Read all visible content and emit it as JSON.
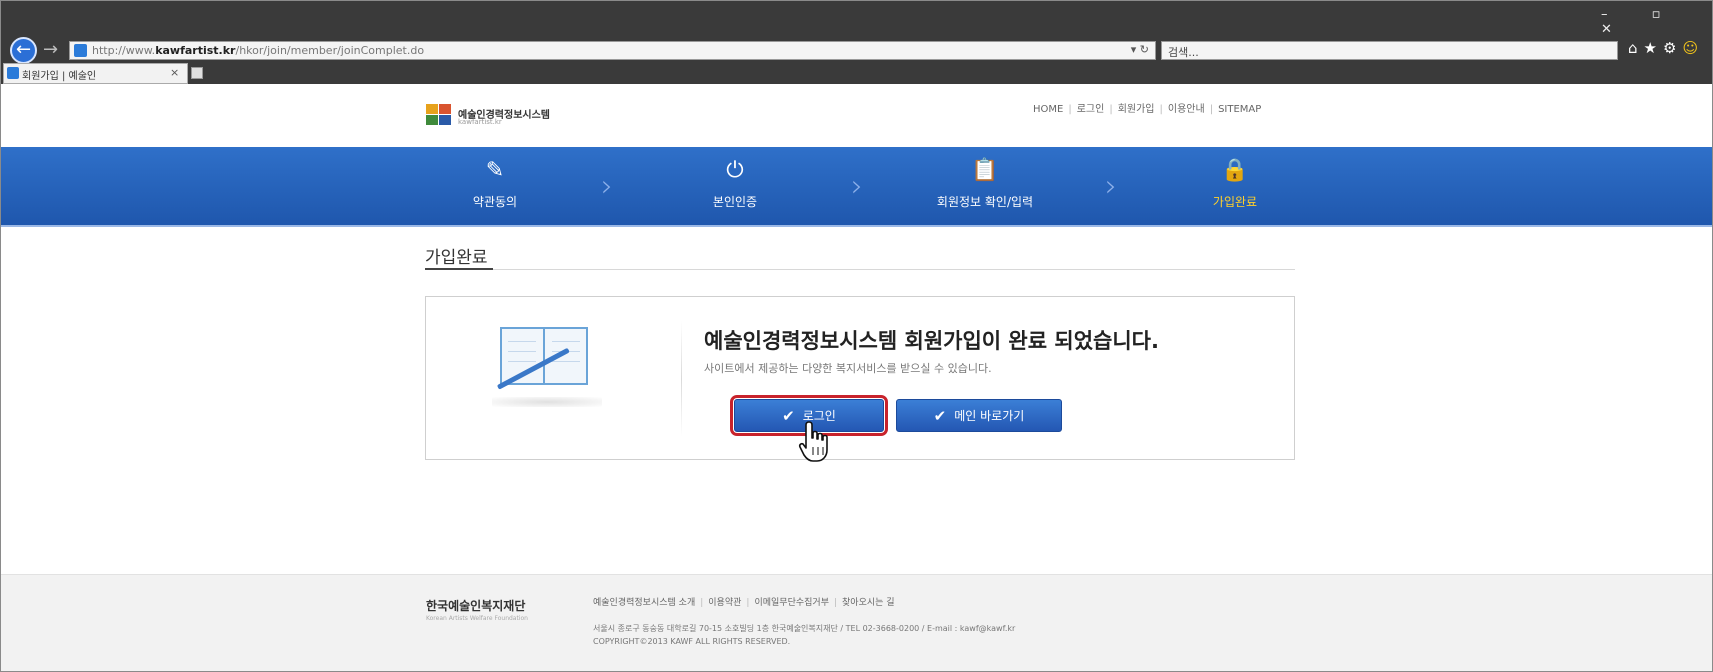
{
  "browser": {
    "url_prefix": "http://www.",
    "url_domain": "kawfartist.kr",
    "url_path": "/hkor/join/member/joinComplet.do",
    "refresh_glyph": "▾ ↻",
    "search_placeholder": "검색...",
    "tab_title": "회원가입 | 예술인",
    "tab_close": "×",
    "win_controls": "–  ▫  ✕",
    "toolbar_icons": [
      "home-icon",
      "star-icon",
      "gear-icon",
      "smiley-icon"
    ]
  },
  "site": {
    "logo_title": "예술인경력정보시스템",
    "logo_sub": "kawfartist.kr",
    "top_links": [
      "HOME",
      "로그인",
      "회원가입",
      "이용안내",
      "SITEMAP"
    ]
  },
  "steps": [
    {
      "label": "약관동의",
      "icon": "document-edit-icon",
      "glyph": "✎"
    },
    {
      "label": "본인인증",
      "icon": "power-icon",
      "glyph": "⏻"
    },
    {
      "label": "회원정보 확인/입력",
      "icon": "clipboard-search-icon",
      "glyph": "📋"
    },
    {
      "label": "가입완료",
      "icon": "lock-icon",
      "glyph": "🔒",
      "active": true
    }
  ],
  "content": {
    "section_title": "가입완료",
    "message_title": "예술인경력정보시스템 회원가입이 완료 되었습니다.",
    "message_sub": "사이트에서 제공하는 다양한 복지서비스를 받으실 수 있습니다.",
    "login_button": "로그인",
    "home_button": "메인 바로가기",
    "check_glyph": "✔"
  },
  "footer": {
    "org_name": "한국예술인복지재단",
    "org_name_en": "Korean Artists Welfare Foundation",
    "links": [
      "예술인경력정보시스템 소개",
      "이용약관",
      "이메일무단수집거부",
      "찾아오시는 길"
    ],
    "address": "서울시 종로구 동숭동 대학로길 70-15 소호빌딩 1층 한국예술인복지재단 / TEL 02-3668-0200 / E-mail : kawf@kawf.kr",
    "copyright": "COPYRIGHT©2013 KAWF ALL RIGHTS RESERVED."
  },
  "colors": {
    "step_bar": "#2463bd",
    "active_step": "#ffd12a",
    "button": "#2a62c0",
    "highlight": "#c8232c"
  }
}
